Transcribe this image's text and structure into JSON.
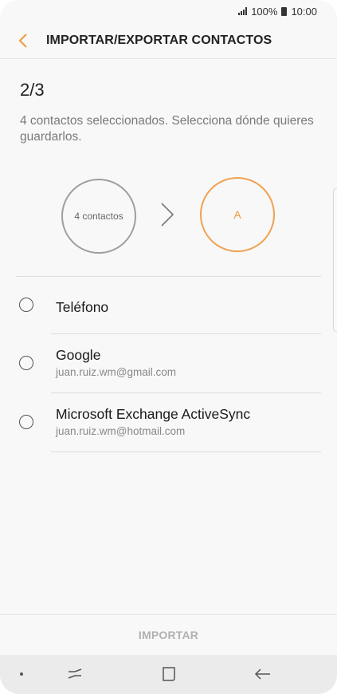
{
  "status_bar": {
    "battery_percent": "100%",
    "time": "10:00"
  },
  "app_bar": {
    "title": "IMPORTAR/EXPORTAR CONTACTOS"
  },
  "content": {
    "step": "2/3",
    "description": "4 contactos seleccionados. Selecciona dónde quieres guardarlos.",
    "source_circle_label": "4 contactos",
    "destination_circle_label": "A"
  },
  "options": [
    {
      "title": "Teléfono",
      "subtitle": ""
    },
    {
      "title": "Google",
      "subtitle": "juan.ruiz.wm@gmail.com"
    },
    {
      "title": "Microsoft Exchange ActiveSync",
      "subtitle": "juan.ruiz.wm@hotmail.com"
    }
  ],
  "footer": {
    "action_label": "IMPORTAR"
  },
  "colors": {
    "accent": "#f09a3c",
    "disabled_text": "#b0b0b0"
  }
}
